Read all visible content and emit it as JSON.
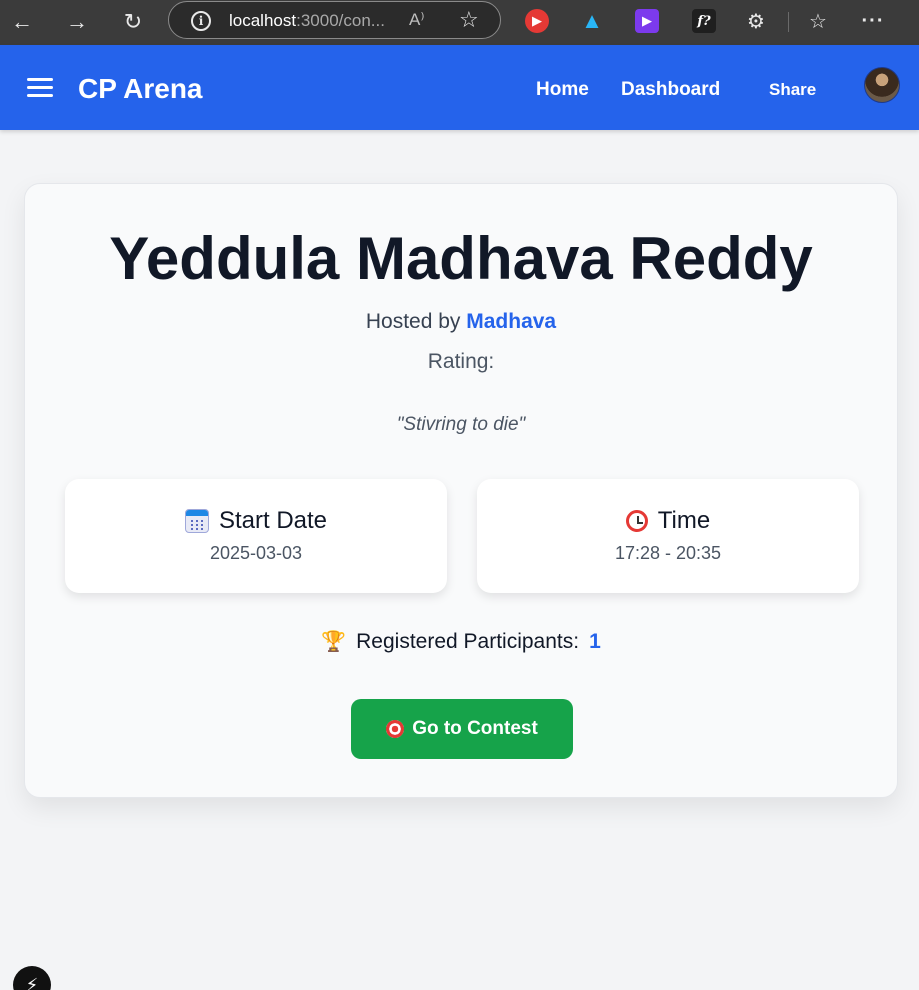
{
  "browser": {
    "url_host": "localhost",
    "url_rest": ":3000/con...",
    "read_aloud": "A⁾",
    "icons": [
      "back-icon",
      "forward-icon",
      "refresh-icon",
      "info-icon",
      "star-icon",
      "puzzle-icon",
      "favorites-icon",
      "more-icon"
    ]
  },
  "navbar": {
    "brand": "CP Arena",
    "links": {
      "home": "Home",
      "dashboard": "Dashboard",
      "share": "Share"
    }
  },
  "contest": {
    "title": "Yeddula Madhava Reddy",
    "hosted_prefix": "Hosted by ",
    "host": "Madhava",
    "rating_label": "Rating:",
    "quote": "\"Stivring to die\"",
    "start_date_label": "Start Date",
    "start_date": "2025-03-03",
    "time_label": "Time",
    "time": "17:28 - 20:35",
    "participants_label": "Registered Participants:",
    "participants_count": "1",
    "go_button": "Go to Contest"
  },
  "colors": {
    "navbar": "#2563eb",
    "accent": "#2563eb",
    "button": "#16a34a"
  }
}
